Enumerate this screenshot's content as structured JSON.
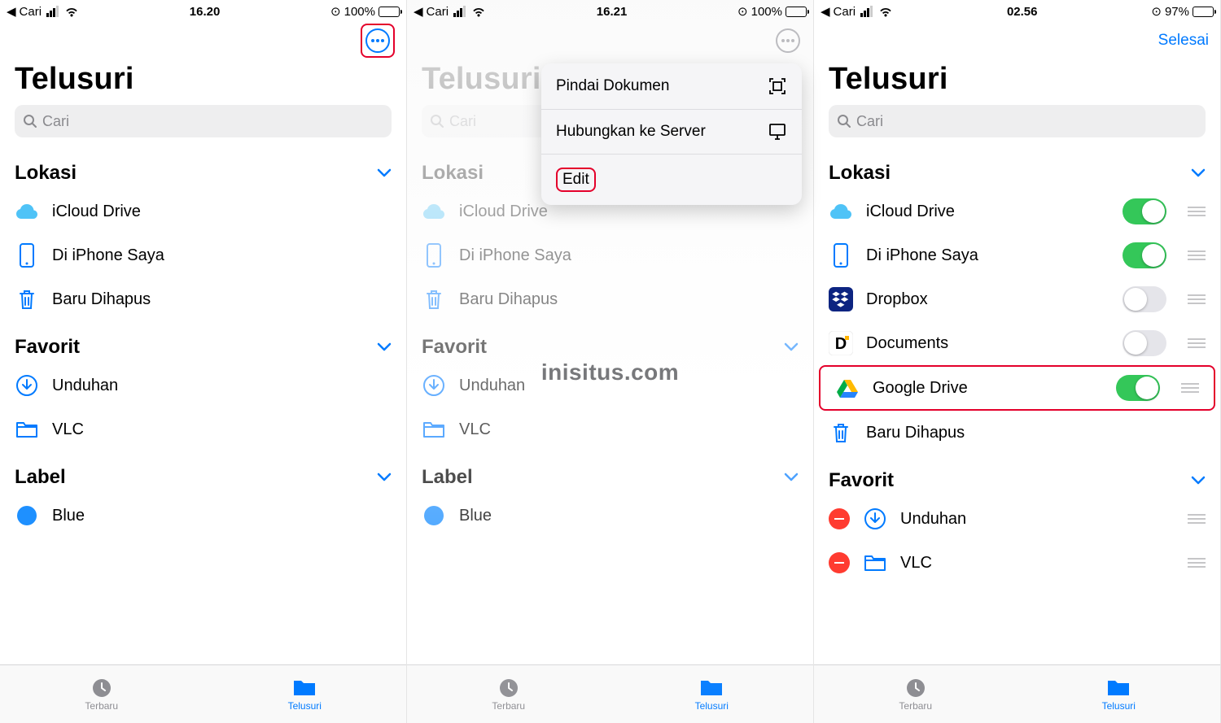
{
  "watermark": "inisitus.com",
  "screens": [
    {
      "status": {
        "back_app": "Cari",
        "time": "16.20",
        "battery_text": "100%",
        "battery_level": 1.0
      },
      "nav": {
        "done": ""
      },
      "title": "Telusuri",
      "search_placeholder": "Cari",
      "sections": {
        "lokasi": {
          "header": "Lokasi",
          "items": [
            {
              "icon": "icloud",
              "label": "iCloud Drive"
            },
            {
              "icon": "iphone",
              "label": "Di iPhone Saya"
            },
            {
              "icon": "trash",
              "label": "Baru Dihapus"
            }
          ]
        },
        "favorit": {
          "header": "Favorit",
          "items": [
            {
              "icon": "download",
              "label": "Unduhan"
            },
            {
              "icon": "folder",
              "label": "VLC"
            }
          ]
        },
        "label": {
          "header": "Label",
          "items": [
            {
              "icon": "tag-blue",
              "label": "Blue"
            }
          ]
        }
      },
      "tabs": {
        "recent": "Terbaru",
        "browse": "Telusuri"
      }
    },
    {
      "status": {
        "back_app": "Cari",
        "time": "16.21",
        "battery_text": "100%",
        "battery_level": 1.0
      },
      "nav": {
        "done": ""
      },
      "title": "Telusuri",
      "search_placeholder": "Cari",
      "popup": [
        {
          "label": "Pindai Dokumen",
          "icon": "scan"
        },
        {
          "label": "Hubungkan ke Server",
          "icon": "server"
        },
        {
          "label": "Edit",
          "icon": "",
          "highlight": true
        }
      ],
      "sections": {
        "lokasi": {
          "header": "Lokasi",
          "items": [
            {
              "icon": "icloud",
              "label": "iCloud Drive"
            },
            {
              "icon": "iphone",
              "label": "Di iPhone Saya"
            },
            {
              "icon": "trash",
              "label": "Baru Dihapus"
            }
          ]
        },
        "favorit": {
          "header": "Favorit",
          "items": [
            {
              "icon": "download",
              "label": "Unduhan"
            },
            {
              "icon": "folder",
              "label": "VLC"
            }
          ]
        },
        "label": {
          "header": "Label",
          "items": [
            {
              "icon": "tag-blue",
              "label": "Blue"
            }
          ]
        }
      },
      "tabs": {
        "recent": "Terbaru",
        "browse": "Telusuri"
      }
    },
    {
      "status": {
        "back_app": "Cari",
        "time": "02.56",
        "battery_text": "97%",
        "battery_level": 0.97
      },
      "nav": {
        "done": "Selesai"
      },
      "title": "Telusuri",
      "search_placeholder": "Cari",
      "sections": {
        "lokasi": {
          "header": "Lokasi",
          "items": [
            {
              "icon": "icloud",
              "label": "iCloud Drive",
              "toggle": true,
              "on": true
            },
            {
              "icon": "iphone",
              "label": "Di iPhone Saya",
              "toggle": true,
              "on": true
            },
            {
              "icon": "dropbox",
              "label": "Dropbox",
              "toggle": true,
              "on": false
            },
            {
              "icon": "documents",
              "label": "Documents",
              "toggle": true,
              "on": false
            },
            {
              "icon": "gdrive",
              "label": "Google Drive",
              "toggle": true,
              "on": true,
              "highlight": true
            },
            {
              "icon": "trash",
              "label": "Baru Dihapus"
            }
          ]
        },
        "favorit": {
          "header": "Favorit",
          "items": [
            {
              "icon": "download",
              "label": "Unduhan",
              "remove": true,
              "drag": true
            },
            {
              "icon": "folder",
              "label": "VLC",
              "remove": true,
              "drag": true
            }
          ]
        }
      },
      "tabs": {
        "recent": "Terbaru",
        "browse": "Telusuri"
      }
    }
  ]
}
